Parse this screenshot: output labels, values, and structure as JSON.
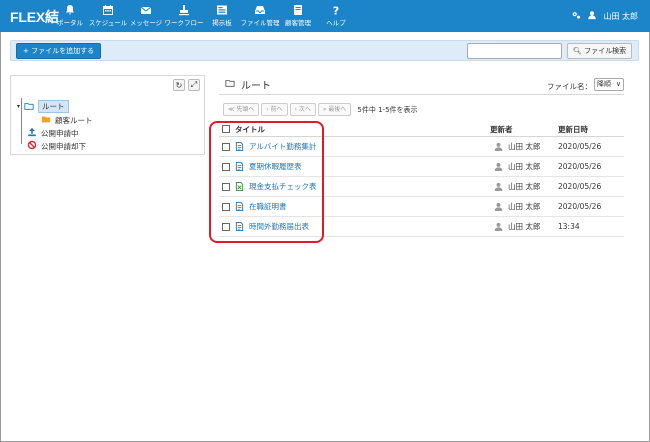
{
  "app": {
    "logo": "FLEX結"
  },
  "nav": [
    {
      "label": "ポータル",
      "icon": "bell-icon"
    },
    {
      "label": "スケジュール",
      "icon": "calendar-icon"
    },
    {
      "label": "メッセージ",
      "icon": "envelope-icon"
    },
    {
      "label": "ワークフロー",
      "icon": "stamp-icon"
    },
    {
      "label": "掲示板",
      "icon": "board-icon"
    },
    {
      "label": "ファイル管理",
      "icon": "inbox-icon"
    },
    {
      "label": "顧客管理",
      "icon": "book-icon"
    },
    {
      "label": "ヘルプ",
      "icon": "question-icon"
    }
  ],
  "user": {
    "name": "山田 太郎"
  },
  "toolbar": {
    "add_label": "+ ファイルを追加する",
    "search_placeholder": "",
    "search_label": "ファイル検索"
  },
  "tree": [
    {
      "label": "ルート",
      "icon": "folder-open-icon",
      "selected": true
    },
    {
      "label": "顧客ルート",
      "icon": "folder-icon"
    },
    {
      "label": "公開申請中",
      "icon": "upload-icon"
    },
    {
      "label": "公開申請却下",
      "icon": "forbidden-icon"
    }
  ],
  "content": {
    "title": "ルート",
    "sort_label": "ファイル名：",
    "sort_value": "降順",
    "pager": [
      "≪ 先頭へ",
      "‹ 前へ",
      "› 次へ",
      "» 最後へ"
    ],
    "count": "5件中 1-5件を表示",
    "headers": {
      "title": "タイトル",
      "updater": "更新者",
      "updated": "更新日時"
    },
    "rows": [
      {
        "title": "アルバイト勤務集計",
        "updater": "山田 太郎",
        "updated": "2020/05/26",
        "type": "doc"
      },
      {
        "title": "夏期休暇履歴表",
        "updater": "山田 太郎",
        "updated": "2020/05/26",
        "type": "doc"
      },
      {
        "title": "現金支払チェック表",
        "updater": "山田 太郎",
        "updated": "2020/05/26",
        "type": "xls"
      },
      {
        "title": "在職証明書",
        "updater": "山田 太郎",
        "updated": "2020/05/26",
        "type": "doc"
      },
      {
        "title": "時間外勤務届出表",
        "updater": "山田 太郎",
        "updated": "13:34",
        "type": "doc"
      }
    ]
  },
  "colors": {
    "nav": "#1c84c8",
    "link": "#1c75bc",
    "highlight": "#d91e2a"
  }
}
